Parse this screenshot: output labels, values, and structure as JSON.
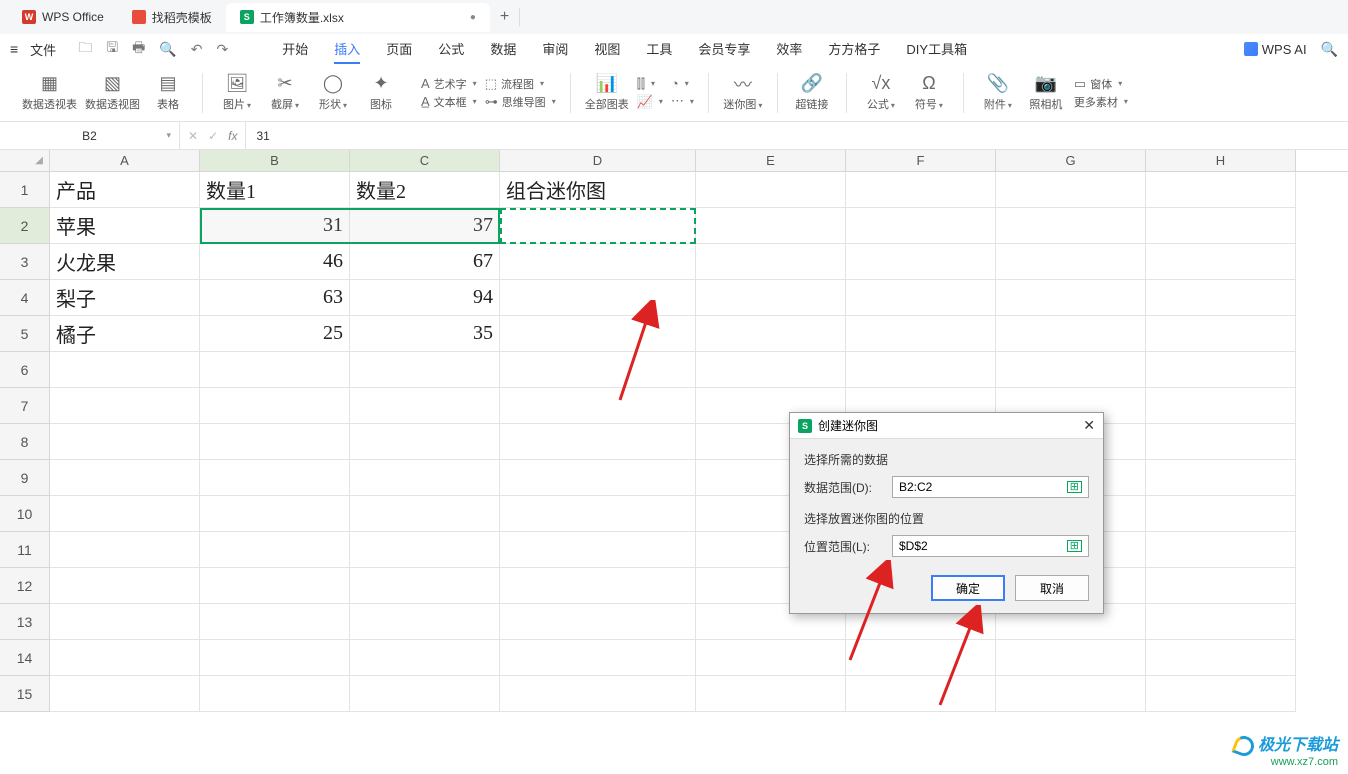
{
  "titlebar": {
    "app": "WPS Office",
    "tab2": "找稻壳模板",
    "tab3": "工作簿数量.xlsx",
    "add": "+"
  },
  "menubar": {
    "file": "文件",
    "tabs": [
      "开始",
      "插入",
      "页面",
      "公式",
      "数据",
      "审阅",
      "视图",
      "工具",
      "会员专享",
      "效率",
      "方方格子",
      "DIY工具箱"
    ],
    "ai": "WPS AI"
  },
  "ribbon": {
    "g1": {
      "a": "数据透视表",
      "b": "数据透视图",
      "c": "表格"
    },
    "g2": {
      "a": "图片",
      "b": "截屏",
      "c": "形状",
      "d": "图标"
    },
    "g3": {
      "a": "艺术字",
      "b": "文本框",
      "c": "流程图",
      "d": "思维导图"
    },
    "g4": {
      "a": "全部图表"
    },
    "g5": {
      "a": "迷你图"
    },
    "g6": {
      "a": "超链接"
    },
    "g7": {
      "a": "公式",
      "b": "符号"
    },
    "g8": {
      "a": "附件",
      "b": "照相机",
      "c": "窗体",
      "d": "更多素材"
    }
  },
  "formula": {
    "namebox": "B2",
    "value": "31"
  },
  "grid": {
    "cols": [
      "A",
      "B",
      "C",
      "D",
      "E",
      "F",
      "G",
      "H"
    ],
    "rows": [
      "1",
      "2",
      "3",
      "4",
      "5",
      "6",
      "7",
      "8",
      "9",
      "10",
      "11",
      "12",
      "13",
      "14",
      "15"
    ],
    "data": {
      "A1": "产品",
      "B1": "数量1",
      "C1": "数量2",
      "D1": "组合迷你图",
      "A2": "苹果",
      "B2": "31",
      "C2": "37",
      "A3": "火龙果",
      "B3": "46",
      "C3": "67",
      "A4": "梨子",
      "B4": "63",
      "C4": "94",
      "A5": "橘子",
      "B5": "25",
      "C5": "35"
    }
  },
  "dialog": {
    "title": "创建迷你图",
    "sec1": "选择所需的数据",
    "lbl1": "数据范围(D):",
    "val1": "B2:C2",
    "sec2": "选择放置迷你图的位置",
    "lbl2": "位置范围(L):",
    "val2": "$D$2",
    "ok": "确定",
    "cancel": "取消"
  },
  "watermark": {
    "name": "极光下载站",
    "url": "www.xz7.com"
  }
}
